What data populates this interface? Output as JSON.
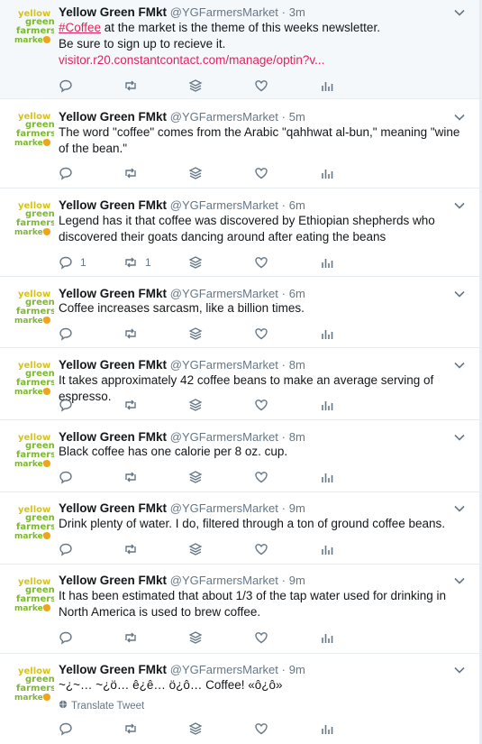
{
  "tweets": [
    {
      "name": "Yellow Green FMkt",
      "handle": "@YGFarmersMarket",
      "dot": "·",
      "time": "3m",
      "hashtag": "#Coffee",
      "text": " at the market is the theme of this weeks newsletter.",
      "text2": "Be sure to sign up to recieve it.",
      "link": "visitor.r20.constantcontact.com/manage/optin?v..."
    },
    {
      "name": "Yellow Green FMkt",
      "handle": "@YGFarmersMarket",
      "dot": "·",
      "time": "5m",
      "text": "The word \"coffee\" comes from the Arabic \"qahhwat al-bun,\" meaning \"wine of the bean.\""
    },
    {
      "name": "Yellow Green FMkt",
      "handle": "@YGFarmersMarket",
      "dot": "·",
      "time": "6m",
      "text": "Legend has it that coffee was discovered by Ethiopian shepherds who discovered their goats dancing around after eating the beans",
      "reply_count": "1",
      "retweet_count": "1"
    },
    {
      "name": "Yellow Green FMkt",
      "handle": "@YGFarmersMarket",
      "dot": "·",
      "time": "6m",
      "text": "Coffee increases sarcasm, like a billion times."
    },
    {
      "name": "Yellow Green FMkt",
      "handle": "@YGFarmersMarket",
      "dot": "·",
      "time": "8m",
      "text": "It takes approximately 42 coffee beans to make an average serving of espresso."
    },
    {
      "name": "Yellow Green FMkt",
      "handle": "@YGFarmersMarket",
      "dot": "·",
      "time": "8m",
      "text": "Black coffee has one calorie per 8 oz. cup."
    },
    {
      "name": "Yellow Green FMkt",
      "handle": "@YGFarmersMarket",
      "dot": "·",
      "time": "9m",
      "text": "Drink plenty of water. I do, filtered through a ton of ground coffee beans."
    },
    {
      "name": "Yellow Green FMkt",
      "handle": "@YGFarmersMarket",
      "dot": "·",
      "time": "9m",
      "text": "It has been estimated that about 1/3 of the tap water used for drinking in North America is used to brew coffee."
    },
    {
      "name": "Yellow Green FMkt",
      "handle": "@YGFarmersMarket",
      "dot": "·",
      "time": "9m",
      "text": "~¿~…  ~¿ö…  ê¿ê…  ö¿ô…  Coffee! «ô¿ô»",
      "translate": "Translate Tweet"
    }
  ],
  "avatar_logo": {
    "line1": "yellow",
    "line2": "green",
    "line3": "farmers",
    "line4": "market"
  },
  "colors": {
    "accent": "#e0245e",
    "muted": "#657786",
    "logo_yellow": "#d6c21a",
    "logo_green": "#7cb82f",
    "logo_orange": "#f2a21b"
  },
  "icons": [
    "reply-icon",
    "retweet-icon",
    "stack-icon",
    "like-icon",
    "analytics-icon",
    "chevron-down-icon",
    "globe-icon"
  ]
}
